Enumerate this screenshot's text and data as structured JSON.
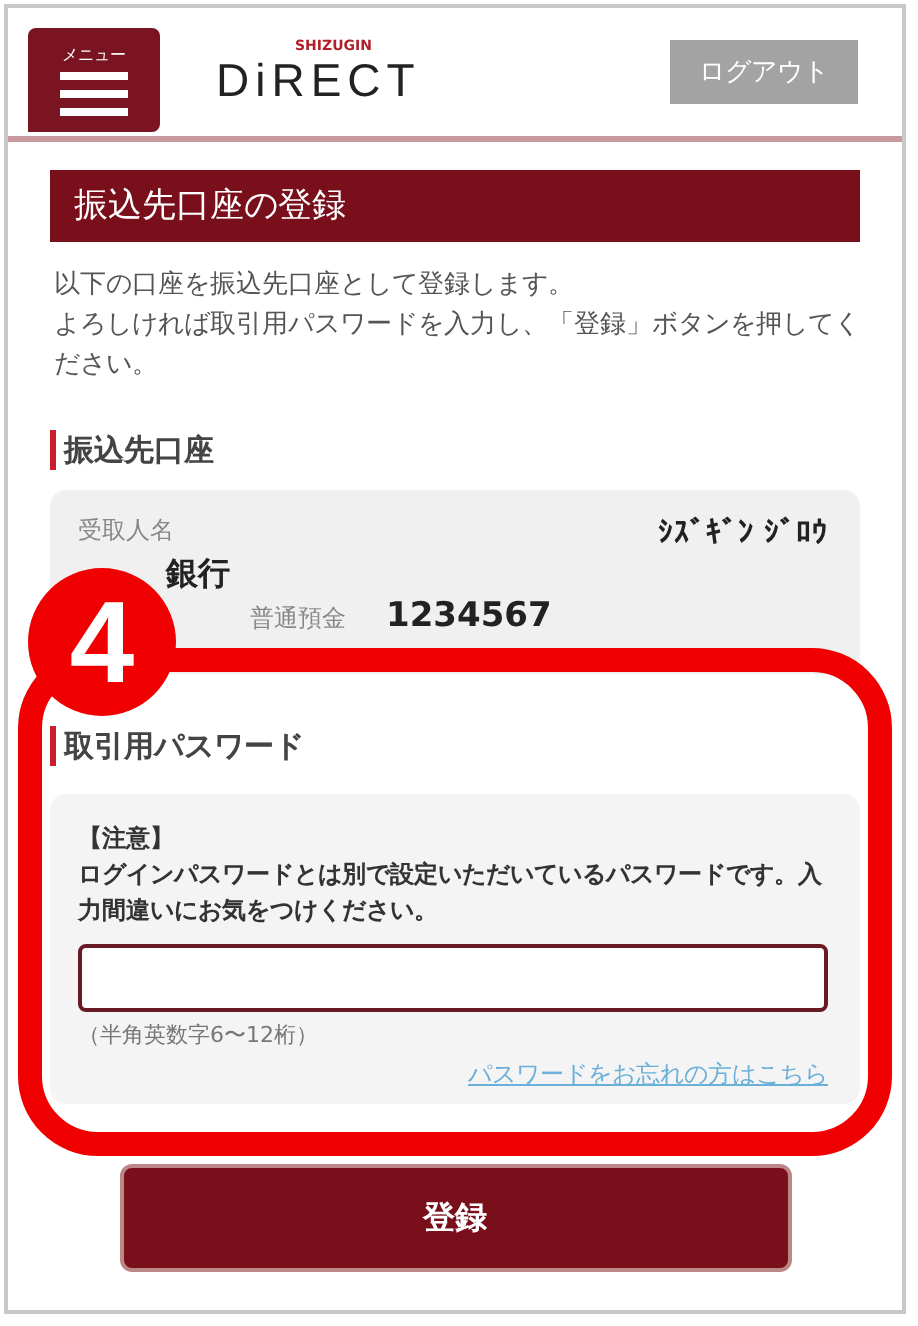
{
  "header": {
    "menu_label": "メニュー",
    "logo_small": "SHIZUGIN",
    "logo": "DiRECT",
    "logout": "ログアウト"
  },
  "page_title": "振込先口座の登録",
  "intro": [
    "以下の口座を振込先口座として登録します。",
    "よろしければ取引用パスワードを入力し、「登録」ボタンを押してください。"
  ],
  "account_section": {
    "heading": "振込先口座",
    "recipient_label": "受取人名",
    "recipient_name": "ｼｽﾞｷﾞﾝ ｼﾞﾛｳ",
    "bank": "銀行",
    "account_type": "普通預金",
    "account_number": "1234567"
  },
  "step_badge": "4",
  "password_section": {
    "heading": "取引用パスワード",
    "notice_title": "【注意】",
    "notice": "ログインパスワードとは別で設定いただいているパスワードです。入力間違いにお気をつけください。",
    "hint": "（半角英数字6〜12桁）",
    "forgot_link": "パスワードをお忘れの方はこちら"
  },
  "submit": "登録"
}
